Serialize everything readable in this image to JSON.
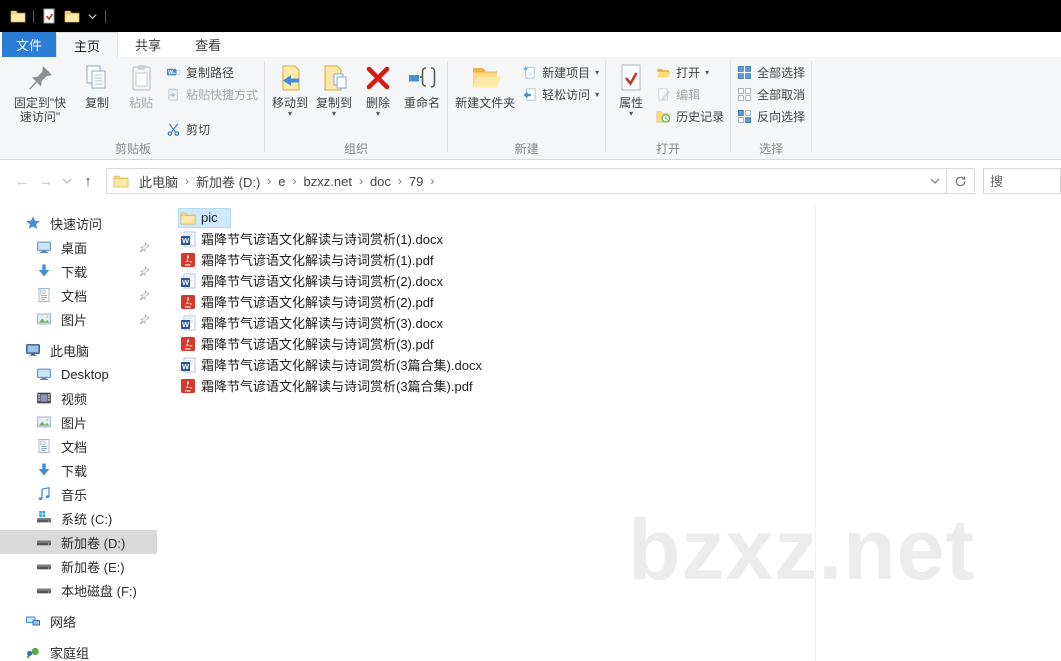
{
  "title_bar": {
    "qat": [
      {
        "icon": "folder-icon"
      },
      {
        "sep": true
      },
      {
        "icon": "properties-qat-icon"
      },
      {
        "icon": "folder-icon"
      },
      {
        "icon": "chevron-down-icon",
        "small": true
      },
      {
        "sep": true
      }
    ]
  },
  "tabs": {
    "file_label": "文件",
    "items": [
      {
        "label": "主页",
        "active": true
      },
      {
        "label": "共享",
        "active": false
      },
      {
        "label": "查看",
        "active": false
      }
    ]
  },
  "ribbon": {
    "groups": [
      {
        "label": "剪贴板",
        "big": [
          {
            "label": "固定到\"快速访问\"",
            "icon": "pin-large-icon"
          },
          {
            "label": "复制",
            "icon": "copy-icon"
          },
          {
            "label": "粘贴",
            "icon": "paste-icon",
            "disabled": true
          }
        ],
        "small": [
          {
            "label": "复制路径",
            "icon": "copy-path-icon"
          },
          {
            "label": "粘贴快捷方式",
            "icon": "paste-shortcut-icon",
            "disabled": true
          },
          {
            "label": "剪切",
            "icon": "cut-icon",
            "gap_before": true
          }
        ]
      },
      {
        "label": "组织",
        "big": [
          {
            "label": "移动到",
            "icon": "move-to-icon",
            "dropdown": true
          },
          {
            "label": "复制到",
            "icon": "copy-to-icon",
            "dropdown": true
          },
          {
            "label": "删除",
            "icon": "delete-icon",
            "dropdown": true
          },
          {
            "label": "重命名",
            "icon": "rename-icon"
          }
        ],
        "small": []
      },
      {
        "label": "新建",
        "big": [
          {
            "label": "新建文件夹",
            "icon": "new-folder-icon"
          }
        ],
        "small": [
          {
            "label": "新建项目",
            "icon": "new-item-icon",
            "dropdown": true
          },
          {
            "label": "轻松访问",
            "icon": "easy-access-icon",
            "dropdown": true
          }
        ]
      },
      {
        "label": "打开",
        "big": [
          {
            "label": "属性",
            "icon": "properties-icon",
            "dropdown": true
          }
        ],
        "small": [
          {
            "label": "打开",
            "icon": "open-icon",
            "dropdown": true
          },
          {
            "label": "编辑",
            "icon": "edit-icon",
            "disabled": true
          },
          {
            "label": "历史记录",
            "icon": "history-icon"
          }
        ]
      },
      {
        "label": "选择",
        "big": [],
        "small": [
          {
            "label": "全部选择",
            "icon": "select-all-icon"
          },
          {
            "label": "全部取消",
            "icon": "select-none-icon"
          },
          {
            "label": "反向选择",
            "icon": "invert-selection-icon"
          }
        ]
      }
    ]
  },
  "address_bar": {
    "breadcrumb": [
      "此电脑",
      "新加卷 (D:)",
      "e",
      "bzxz.net",
      "doc",
      "79"
    ],
    "search_placeholder": "搜"
  },
  "sidebar": {
    "sections": [
      {
        "items": [
          {
            "label": "快速访问",
            "icon": "quick-access-icon",
            "level": 0
          },
          {
            "label": "桌面",
            "icon": "desktop-icon",
            "level": 1,
            "pinned": true
          },
          {
            "label": "下载",
            "icon": "downloads-icon",
            "level": 1,
            "pinned": true
          },
          {
            "label": "文档",
            "icon": "documents-icon",
            "level": 1,
            "pinned": true
          },
          {
            "label": "图片",
            "icon": "pictures-icon",
            "level": 1,
            "pinned": true
          }
        ]
      },
      {
        "items": [
          {
            "label": "此电脑",
            "icon": "this-pc-icon",
            "level": 0
          },
          {
            "label": "Desktop",
            "icon": "desktop-icon",
            "level": 1
          },
          {
            "label": "视频",
            "icon": "videos-icon",
            "level": 1
          },
          {
            "label": "图片",
            "icon": "pictures-icon",
            "level": 1
          },
          {
            "label": "文档",
            "icon": "documents-icon",
            "level": 1
          },
          {
            "label": "下载",
            "icon": "downloads-icon",
            "level": 1
          },
          {
            "label": "音乐",
            "icon": "music-icon",
            "level": 1
          },
          {
            "label": "系统 (C:)",
            "icon": "system-drive-icon",
            "level": 1
          },
          {
            "label": "新加卷 (D:)",
            "icon": "drive-icon",
            "level": 1,
            "selected": true
          },
          {
            "label": "新加卷 (E:)",
            "icon": "drive-icon",
            "level": 1
          },
          {
            "label": "本地磁盘 (F:)",
            "icon": "drive-icon",
            "level": 1
          }
        ]
      },
      {
        "items": [
          {
            "label": "网络",
            "icon": "network-icon",
            "level": 0
          }
        ]
      },
      {
        "items": [
          {
            "label": "家庭组",
            "icon": "homegroup-icon",
            "level": 0
          }
        ]
      }
    ]
  },
  "files": [
    {
      "name": "pic",
      "icon": "folder-icon",
      "selected": true
    },
    {
      "name": "霜降节气谚语文化解读与诗词赏析(1).docx",
      "icon": "word-icon"
    },
    {
      "name": "霜降节气谚语文化解读与诗词赏析(1).pdf",
      "icon": "pdf-icon"
    },
    {
      "name": "霜降节气谚语文化解读与诗词赏析(2).docx",
      "icon": "word-icon"
    },
    {
      "name": "霜降节气谚语文化解读与诗词赏析(2).pdf",
      "icon": "pdf-icon"
    },
    {
      "name": "霜降节气谚语文化解读与诗词赏析(3).docx",
      "icon": "word-icon"
    },
    {
      "name": "霜降节气谚语文化解读与诗词赏析(3).pdf",
      "icon": "pdf-icon"
    },
    {
      "name": "霜降节气谚语文化解读与诗词赏析(3篇合集).docx",
      "icon": "word-icon"
    },
    {
      "name": "霜降节气谚语文化解读与诗词赏析(3篇合集).pdf",
      "icon": "pdf-icon"
    }
  ],
  "watermark": "bzxz.net",
  "colors": {
    "accent_blue": "#2a7cd4",
    "file_selection": "#cde8ff",
    "sidebar_selection": "#d9d9d9",
    "titlebar": "#000000"
  }
}
